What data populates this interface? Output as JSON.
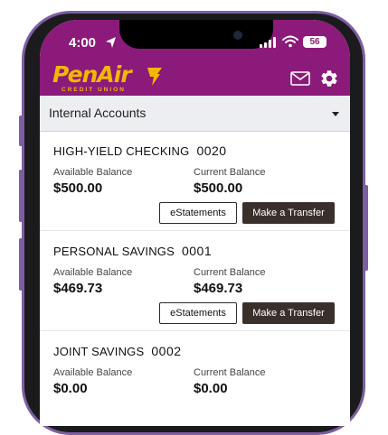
{
  "status_bar": {
    "time": "4:00",
    "battery": "56"
  },
  "brand": {
    "name": "PenAir",
    "subtitle": "CREDIT UNION"
  },
  "account_selector": {
    "label": "Internal Accounts"
  },
  "accounts": [
    {
      "name": "HIGH-YIELD CHECKING",
      "number": "0020",
      "available_label": "Available Balance",
      "available": "$500.00",
      "current_label": "Current Balance",
      "current": "$500.00",
      "estatements": "eStatements",
      "transfer": "Make a Transfer"
    },
    {
      "name": "PERSONAL SAVINGS",
      "number": "0001",
      "available_label": "Available Balance",
      "available": "$469.73",
      "current_label": "Current Balance",
      "current": "$469.73",
      "estatements": "eStatements",
      "transfer": "Make a Transfer"
    },
    {
      "name": "JOINT SAVINGS",
      "number": "0002",
      "available_label": "Available Balance",
      "available": "$0.00",
      "current_label": "Current Balance",
      "current": "$0.00"
    }
  ],
  "icons": {
    "mail": "mail-icon",
    "settings": "gear-icon",
    "location": "location-arrow-icon",
    "wifi": "wifi-icon",
    "signal": "signal-icon",
    "dropdown": "chevron-down-icon"
  },
  "colors": {
    "header": "#8c1a7a",
    "brand_gold": "#f2b705",
    "transfer_button": "#3a302b",
    "selector_bg": "#eceef1",
    "frame": "#7d5ea3"
  }
}
